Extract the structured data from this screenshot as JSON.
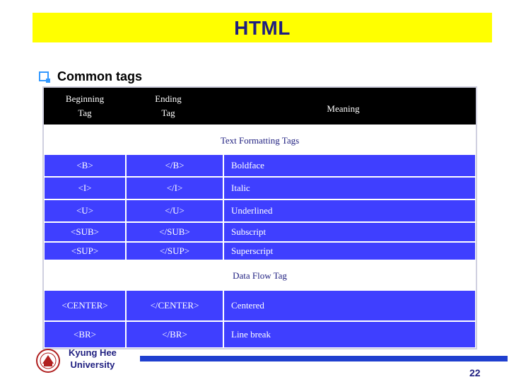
{
  "title": "HTML",
  "bullet": "Common tags",
  "table": {
    "headers": {
      "beginning_line1": "Beginning",
      "beginning_line2": "Tag",
      "ending_line1": "Ending",
      "ending_line2": "Tag",
      "meaning": "Meaning"
    },
    "sections": {
      "text_formatting": "Text Formatting Tags",
      "data_flow": "Data Flow Tag"
    },
    "text_formatting_rows": [
      {
        "begin": "<B>",
        "end": "</B>",
        "meaning": "Boldface"
      },
      {
        "begin": "<I>",
        "end": "</I>",
        "meaning": "Italic"
      },
      {
        "begin": "<U>",
        "end": "</U>",
        "meaning": "Underlined"
      },
      {
        "begin": "<SUB>",
        "end": "</SUB>",
        "meaning": "Subscript"
      },
      {
        "begin": "<SUP>",
        "end": "</SUP>",
        "meaning": "Superscript"
      }
    ],
    "data_flow_rows": [
      {
        "begin": "<CENTER>",
        "end": "</CENTER>",
        "meaning": "Centered"
      },
      {
        "begin": "<BR>",
        "end": "</BR>",
        "meaning": "Line break"
      }
    ]
  },
  "footer": {
    "university_line1": "Kyung Hee",
    "university_line2": "University",
    "page_number": "22"
  },
  "colors": {
    "title_bar": "#ffff00",
    "title_text": "#1f1f80",
    "table_header": "#000000",
    "table_row": "#3f3fff",
    "footer_line": "#1f3fcf"
  },
  "icons": {
    "bullet": "checkbox-bullet-icon",
    "logo": "university-seal-icon"
  }
}
